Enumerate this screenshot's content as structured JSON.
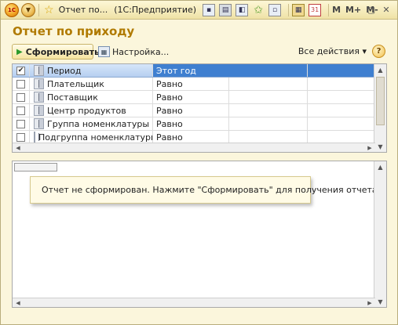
{
  "window": {
    "tab_title": "Отчет по...",
    "app_title": "(1С:Предприятие)",
    "logo_text": "1С",
    "memory": {
      "m": "M",
      "m_plus": "M+",
      "m_minus": "M-"
    }
  },
  "form": {
    "title": "Отчет по приходу"
  },
  "toolbar": {
    "run_label": "Сформировать",
    "settings_label": "Настройка...",
    "all_actions_label": "Все действия",
    "help_label": "?"
  },
  "grid": {
    "header": {
      "checked": true,
      "name": "Период",
      "value": "Этот год"
    },
    "rows": [
      {
        "checked": false,
        "name": "Плательщик",
        "condition": "Равно",
        "value": ""
      },
      {
        "checked": false,
        "name": "Поставщик",
        "condition": "Равно",
        "value": ""
      },
      {
        "checked": false,
        "name": "Центр продуктов",
        "condition": "Равно",
        "value": ""
      },
      {
        "checked": false,
        "name": "Группа номенклатуры",
        "condition": "Равно",
        "value": ""
      },
      {
        "checked": false,
        "name": "Подгруппа номенклатуры",
        "condition": "Равно",
        "value": ""
      }
    ]
  },
  "report": {
    "message": "Отчет не сформирован. Нажмите \"Сформировать\" для получения отчета."
  },
  "colors": {
    "title": "#b07a00",
    "selection": "#3f7fd0",
    "window_bg": "#fbf6dc"
  }
}
